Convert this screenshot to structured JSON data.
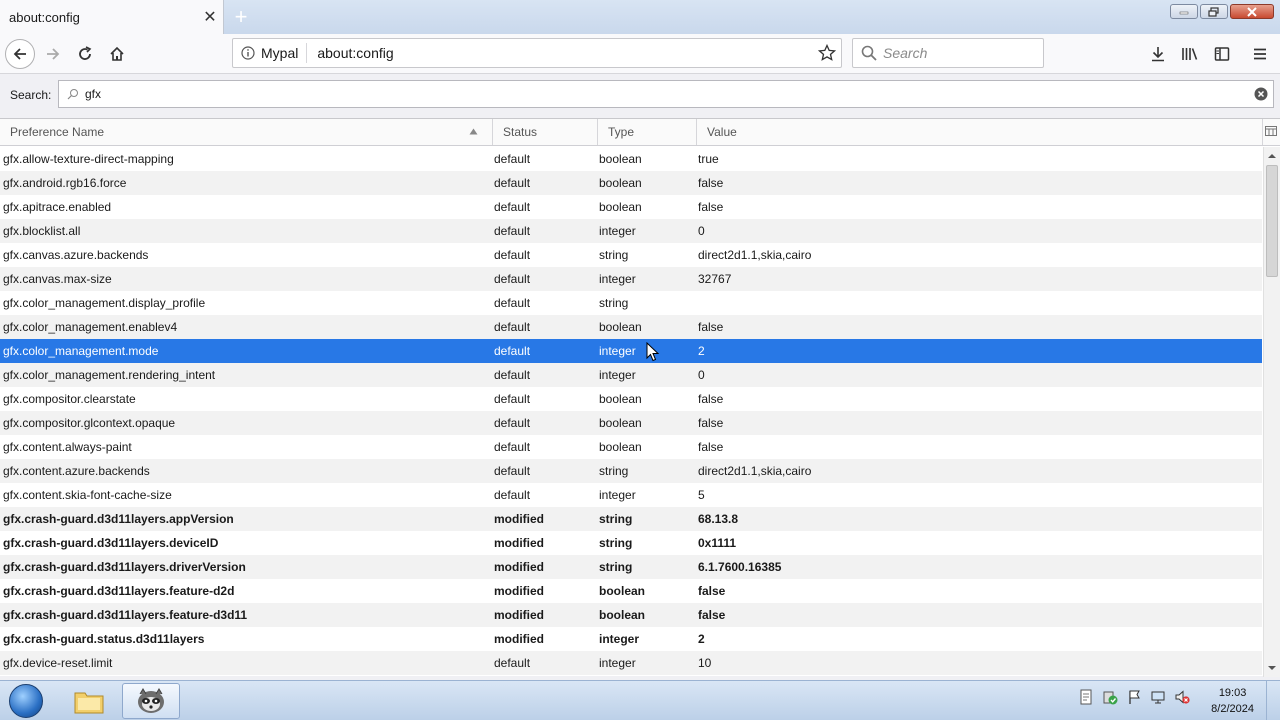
{
  "tab": {
    "title": "about:config",
    "close": "✕",
    "new_tab": "+"
  },
  "navbar": {
    "identity_label": "Mypal",
    "url": "about:config",
    "search_placeholder": "Search"
  },
  "prefs": {
    "search_label": "Search:",
    "search_value": "gfx",
    "columns": {
      "name": "Preference Name",
      "status": "Status",
      "type": "Type",
      "value": "Value"
    },
    "rows": [
      {
        "name": "gfx.allow-texture-direct-mapping",
        "status": "default",
        "type": "boolean",
        "value": "true"
      },
      {
        "name": "gfx.android.rgb16.force",
        "status": "default",
        "type": "boolean",
        "value": "false"
      },
      {
        "name": "gfx.apitrace.enabled",
        "status": "default",
        "type": "boolean",
        "value": "false"
      },
      {
        "name": "gfx.blocklist.all",
        "status": "default",
        "type": "integer",
        "value": "0"
      },
      {
        "name": "gfx.canvas.azure.backends",
        "status": "default",
        "type": "string",
        "value": "direct2d1.1,skia,cairo"
      },
      {
        "name": "gfx.canvas.max-size",
        "status": "default",
        "type": "integer",
        "value": "32767"
      },
      {
        "name": "gfx.color_management.display_profile",
        "status": "default",
        "type": "string",
        "value": ""
      },
      {
        "name": "gfx.color_management.enablev4",
        "status": "default",
        "type": "boolean",
        "value": "false"
      },
      {
        "name": "gfx.color_management.mode",
        "status": "default",
        "type": "integer",
        "value": "2"
      },
      {
        "name": "gfx.color_management.rendering_intent",
        "status": "default",
        "type": "integer",
        "value": "0"
      },
      {
        "name": "gfx.compositor.clearstate",
        "status": "default",
        "type": "boolean",
        "value": "false"
      },
      {
        "name": "gfx.compositor.glcontext.opaque",
        "status": "default",
        "type": "boolean",
        "value": "false"
      },
      {
        "name": "gfx.content.always-paint",
        "status": "default",
        "type": "boolean",
        "value": "false"
      },
      {
        "name": "gfx.content.azure.backends",
        "status": "default",
        "type": "string",
        "value": "direct2d1.1,skia,cairo"
      },
      {
        "name": "gfx.content.skia-font-cache-size",
        "status": "default",
        "type": "integer",
        "value": "5"
      },
      {
        "name": "gfx.crash-guard.d3d11layers.appVersion",
        "status": "modified",
        "type": "string",
        "value": "68.13.8"
      },
      {
        "name": "gfx.crash-guard.d3d11layers.deviceID",
        "status": "modified",
        "type": "string",
        "value": "0x1111"
      },
      {
        "name": "gfx.crash-guard.d3d11layers.driverVersion",
        "status": "modified",
        "type": "string",
        "value": "6.1.7600.16385"
      },
      {
        "name": "gfx.crash-guard.d3d11layers.feature-d2d",
        "status": "modified",
        "type": "boolean",
        "value": "false"
      },
      {
        "name": "gfx.crash-guard.d3d11layers.feature-d3d11",
        "status": "modified",
        "type": "boolean",
        "value": "false"
      },
      {
        "name": "gfx.crash-guard.status.d3d11layers",
        "status": "modified",
        "type": "integer",
        "value": "2"
      },
      {
        "name": "gfx.device-reset.limit",
        "status": "default",
        "type": "integer",
        "value": "10"
      }
    ],
    "selected_row": "gfx.color_management.mode"
  },
  "taskbar": {
    "time": "19:03",
    "date": "8/2/2024"
  },
  "colors": {
    "selection": "#2878e6",
    "taskbar": "#bcd0e8"
  }
}
